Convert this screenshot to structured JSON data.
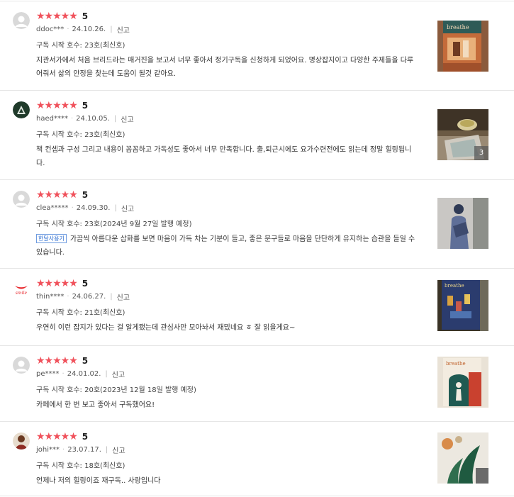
{
  "star_color": "#f0515b",
  "reviews": [
    {
      "stars": "★★★★★",
      "score": "5",
      "user": "ddoc***",
      "date": "24.10.26.",
      "report_label": "신고",
      "issue": "구독 시작 호수: 23호(최신호)",
      "body": "지관서가에서 처음 브리드라는 매거진을 보고서 너무 좋아서 정기구독을 신청하게 되었어요. 명상잡지이고 다양한 주제들을 다루어줘서 삶의 안정을 찾는데 도움이 될것 같아요.",
      "avatar": "default-avatar-icon"
    },
    {
      "stars": "★★★★★",
      "score": "5",
      "user": "haed****",
      "date": "24.10.05.",
      "report_label": "신고",
      "issue": "구독 시작 호수: 23호(최신호)",
      "body": "책 컨셉과 구성 그리고 내용이 꼼꼼하고 가독성도 좋아서 너무 만족합니다. 출,퇴근시에도 요가수련전에도 읽는데 정말 힐링됩니다.",
      "photo_count": "3",
      "avatar": "profile-photo"
    },
    {
      "stars": "★★★★★",
      "score": "5",
      "user": "clea*****",
      "date": "24.09.30.",
      "report_label": "신고",
      "issue": "구독 시작 호수: 23호(2024년 9월 27일 발행 예정)",
      "badge": "한달사용기",
      "body": "가끔씩 아름다운 삽화를 보면 마음이 가득 차는 기분이 들고, 좋은 문구들로 마음을 단단하게 유지하는 습관을 들일 수 있습니다.",
      "avatar": "default-avatar-icon"
    },
    {
      "stars": "★★★★★",
      "score": "5",
      "user": "thin****",
      "date": "24.06.27.",
      "report_label": "신고",
      "issue": "구독 시작 호수: 21호(최신호)",
      "body": "우연히 이런 잡지가 있다는 걸 알게됐는데 관심사만 모아놔서 재밌네요 ㅎ 잘 읽을게요~",
      "avatar": "smile-logo",
      "avatar_text": "smile"
    },
    {
      "stars": "★★★★★",
      "score": "5",
      "user": "pe****",
      "date": "24.01.02.",
      "report_label": "신고",
      "issue": "구독 시작 호수: 20호(2023년 12월 18일 발행 예정)",
      "body": "카페에서 한 번 보고 좋아서 구독했어요!",
      "avatar": "default-avatar-icon"
    },
    {
      "stars": "★★★★★",
      "score": "5",
      "user": "johi***",
      "date": "23.07.17.",
      "report_label": "신고",
      "issue": "구독 시작 호수: 18호(최신호)",
      "body": "언제나 저의 힐링이죠 재구독.. 사랑입니다",
      "avatar": "profile-photo"
    }
  ]
}
